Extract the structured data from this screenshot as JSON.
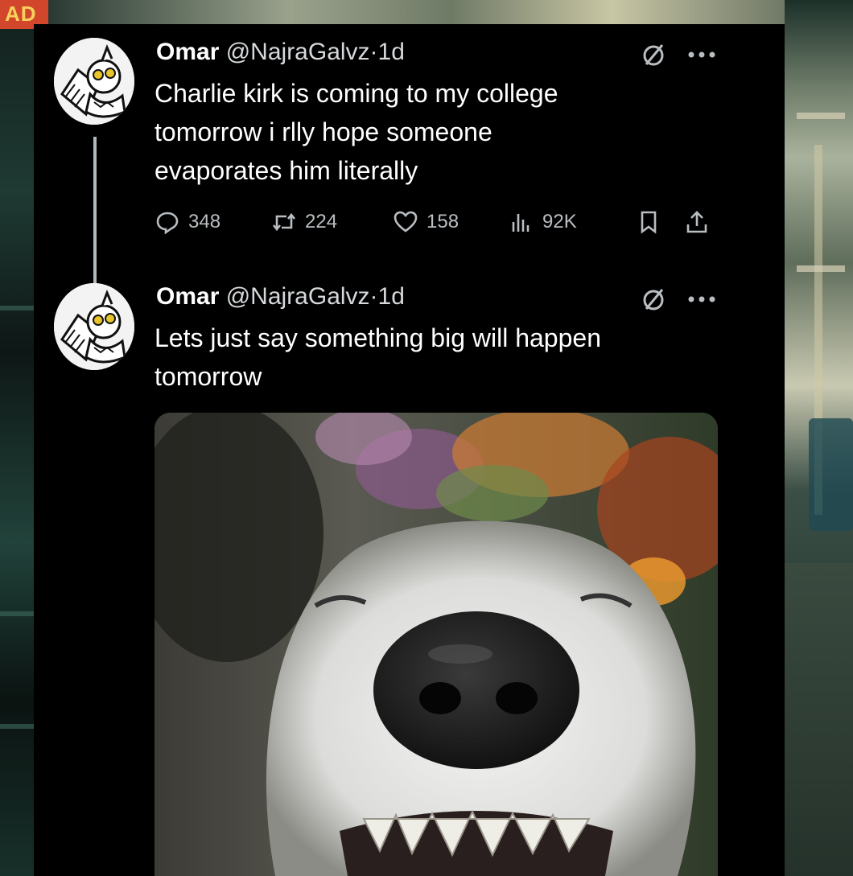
{
  "background": {
    "sign_text": "AD"
  },
  "tweets": [
    {
      "display_name": "Omar",
      "handle": "@NajraGalvz",
      "separator": "·",
      "time": "1d",
      "text": "Charlie kirk is coming to my college\ntomorrow i rlly hope someone\nevaporates him literally",
      "metrics": {
        "replies": "348",
        "reposts": "224",
        "likes": "158",
        "views": "92K"
      }
    },
    {
      "display_name": "Omar",
      "handle": "@NajraGalvz",
      "separator": "·",
      "time": "1d",
      "text": "Lets just say something big will happen\ntomorrow",
      "media": {
        "description_icon": "smiling-dog-photo"
      }
    }
  ],
  "icons": {
    "grok": "grok-slash-circle-icon",
    "more": "more-options-icon",
    "reply": "reply-bubble-icon",
    "repost": "repost-arrows-icon",
    "like": "heart-icon",
    "views": "views-bars-icon",
    "bookmark": "bookmark-icon",
    "share": "share-icon"
  },
  "colors": {
    "card_background": "#000000",
    "text_primary": "#ffffff",
    "text_secondary": "#b9bec2",
    "thread_line": "#cfd9de"
  }
}
